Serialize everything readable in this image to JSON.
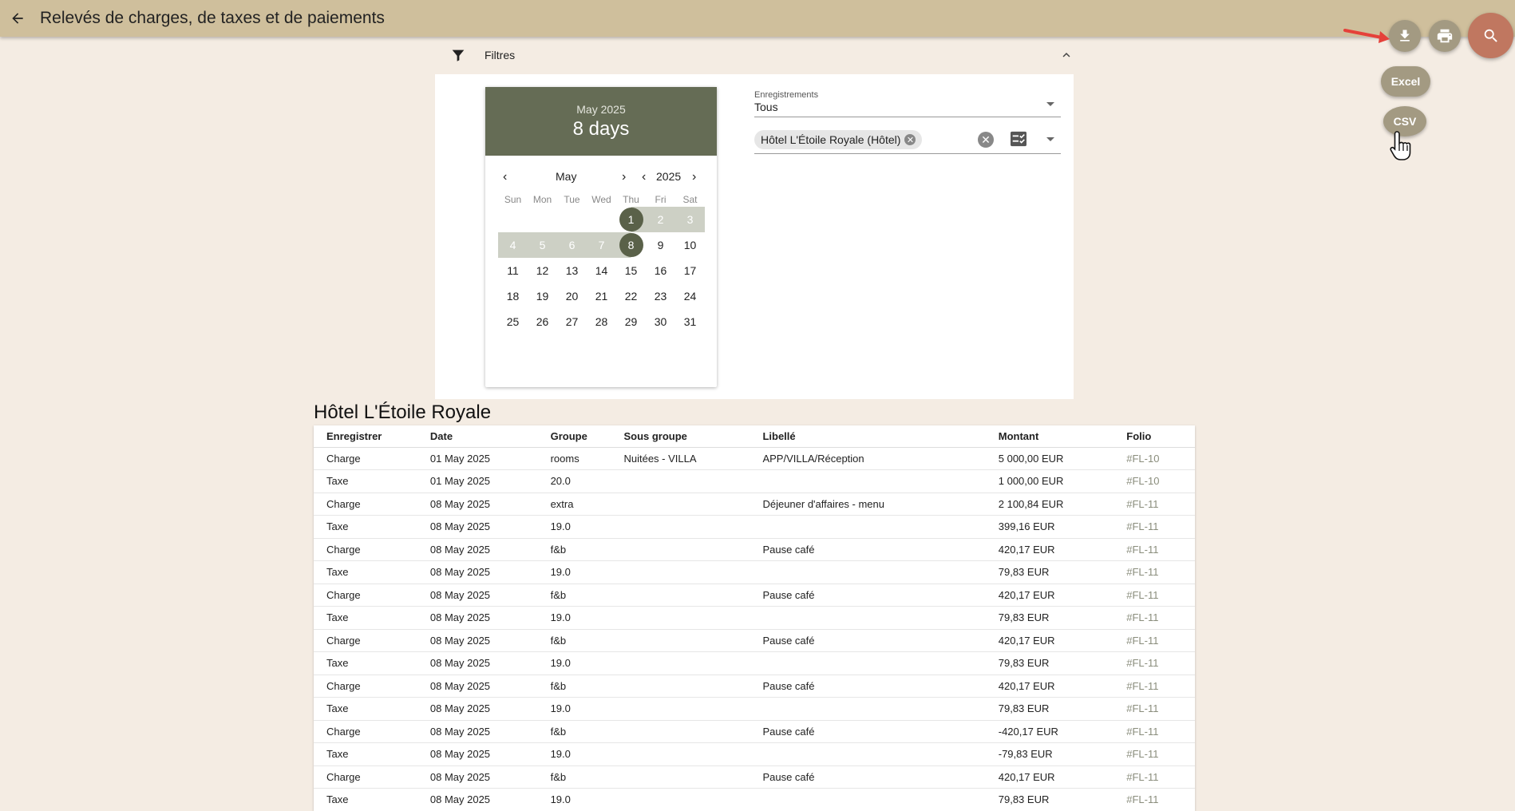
{
  "header": {
    "title": "Relevés de charges, de taxes et de paiements"
  },
  "actions": {
    "excel_label": "Excel",
    "csv_label": "CSV"
  },
  "filters": {
    "label": "Filtres",
    "records_label": "Enregistrements",
    "records_value": "Tous",
    "hotel_chip": "Hôtel L'Étoile Royale (Hôtel)"
  },
  "calendar": {
    "header_sub": "May 2025",
    "header_main": "8 days",
    "month": "May",
    "year": "2025",
    "weekdays": [
      "Sun",
      "Mon",
      "Tue",
      "Wed",
      "Thu",
      "Fri",
      "Sat"
    ],
    "weeks": [
      [
        "",
        "",
        "",
        "",
        "1",
        "2",
        "3"
      ],
      [
        "4",
        "5",
        "6",
        "7",
        "8",
        "9",
        "10"
      ],
      [
        "11",
        "12",
        "13",
        "14",
        "15",
        "16",
        "17"
      ],
      [
        "18",
        "19",
        "20",
        "21",
        "22",
        "23",
        "24"
      ],
      [
        "25",
        "26",
        "27",
        "28",
        "29",
        "30",
        "31"
      ]
    ],
    "range_start": "1",
    "range_end": "8"
  },
  "report": {
    "section_title": "Hôtel L'Étoile Royale",
    "columns": [
      "Enregistrer",
      "Date",
      "Groupe",
      "Sous groupe",
      "Libellé",
      "Montant",
      "Folio"
    ],
    "rows": [
      [
        "Charge",
        "01 May 2025",
        "rooms",
        "Nuitées - VILLA",
        "APP/VILLA/Réception",
        "5 000,00 EUR",
        "#FL-10"
      ],
      [
        "Taxe",
        "01 May 2025",
        "20.0",
        "",
        "",
        "1 000,00 EUR",
        "#FL-10"
      ],
      [
        "Charge",
        "08 May 2025",
        "extra",
        "",
        "Déjeuner d'affaires - menu",
        "2 100,84 EUR",
        "#FL-11"
      ],
      [
        "Taxe",
        "08 May 2025",
        "19.0",
        "",
        "",
        "399,16 EUR",
        "#FL-11"
      ],
      [
        "Charge",
        "08 May 2025",
        "f&b",
        "",
        "Pause café",
        "420,17 EUR",
        "#FL-11"
      ],
      [
        "Taxe",
        "08 May 2025",
        "19.0",
        "",
        "",
        "79,83 EUR",
        "#FL-11"
      ],
      [
        "Charge",
        "08 May 2025",
        "f&b",
        "",
        "Pause café",
        "420,17 EUR",
        "#FL-11"
      ],
      [
        "Taxe",
        "08 May 2025",
        "19.0",
        "",
        "",
        "79,83 EUR",
        "#FL-11"
      ],
      [
        "Charge",
        "08 May 2025",
        "f&b",
        "",
        "Pause café",
        "420,17 EUR",
        "#FL-11"
      ],
      [
        "Taxe",
        "08 May 2025",
        "19.0",
        "",
        "",
        "79,83 EUR",
        "#FL-11"
      ],
      [
        "Charge",
        "08 May 2025",
        "f&b",
        "",
        "Pause café",
        "420,17 EUR",
        "#FL-11"
      ],
      [
        "Taxe",
        "08 May 2025",
        "19.0",
        "",
        "",
        "79,83 EUR",
        "#FL-11"
      ],
      [
        "Charge",
        "08 May 2025",
        "f&b",
        "",
        "Pause café",
        "-420,17 EUR",
        "#FL-11"
      ],
      [
        "Taxe",
        "08 May 2025",
        "19.0",
        "",
        "",
        "-79,83 EUR",
        "#FL-11"
      ],
      [
        "Charge",
        "08 May 2025",
        "f&b",
        "",
        "Pause café",
        "420,17 EUR",
        "#FL-11"
      ],
      [
        "Taxe",
        "08 May 2025",
        "19.0",
        "",
        "",
        "79,83 EUR",
        "#FL-11"
      ]
    ]
  },
  "icons": {
    "back": "arrow-left-icon",
    "download": "download-icon",
    "print": "printer-icon",
    "search": "search-icon",
    "filter": "filter-icon",
    "collapse": "chevron-up-icon",
    "checklist": "checklist-icon"
  },
  "colors": {
    "topbar": "#cfbf9c",
    "calendar_header": "#656c55",
    "range_fill": "#cdd0c5",
    "fab_search": "#c07760",
    "fab": "#a39a82"
  }
}
